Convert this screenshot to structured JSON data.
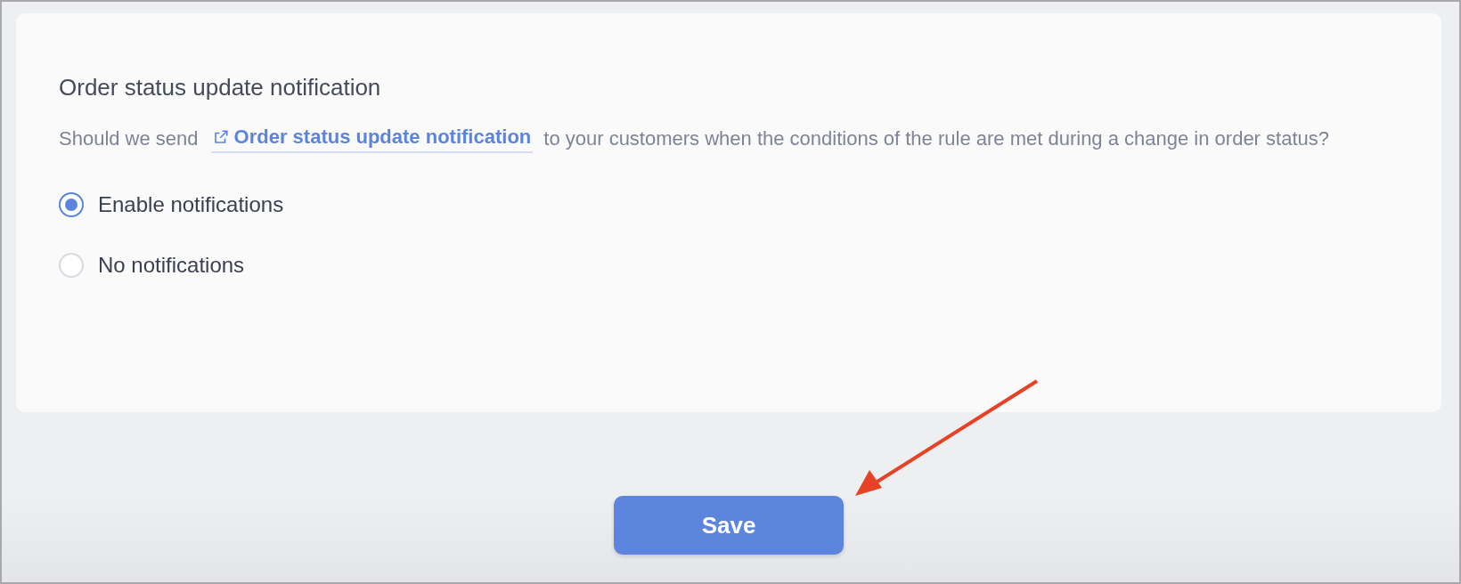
{
  "section": {
    "title": "Order status update notification",
    "description": {
      "before": "Should we send",
      "link": "Order status update notification",
      "after": "to your customers when the conditions of the rule are met during a change in order status?"
    },
    "options": [
      {
        "label": "Enable notifications",
        "selected": true
      },
      {
        "label": "No notifications",
        "selected": false
      }
    ]
  },
  "save_button": {
    "label": "Save"
  }
}
